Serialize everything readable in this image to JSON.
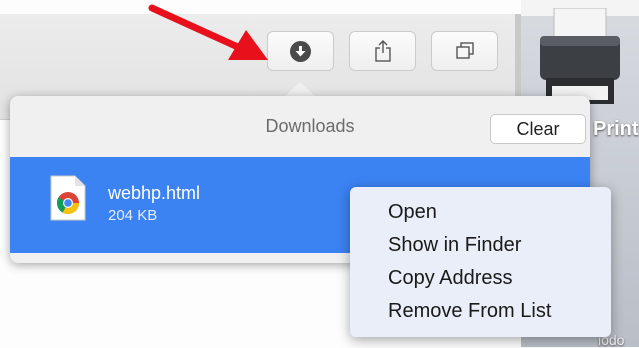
{
  "toolbar": {
    "buttons": [
      {
        "name": "downloads",
        "icon": "download-circle-icon"
      },
      {
        "name": "share",
        "icon": "share-icon"
      },
      {
        "name": "tab-overview",
        "icon": "tabs-icon"
      }
    ]
  },
  "desktop": {
    "printer_label": "Print",
    "secondary_label": "iodo"
  },
  "downloads_popover": {
    "title": "Downloads",
    "clear_label": "Clear",
    "items": [
      {
        "file_name": "webhp.html",
        "size": "204 KB",
        "icon": "chrome-html-file-icon"
      }
    ]
  },
  "context_menu": {
    "items": [
      "Open",
      "Show in Finder",
      "Copy Address",
      "Remove From List"
    ]
  },
  "colors": {
    "selection": "#3b82f2",
    "annotation_arrow": "#e8101a"
  }
}
